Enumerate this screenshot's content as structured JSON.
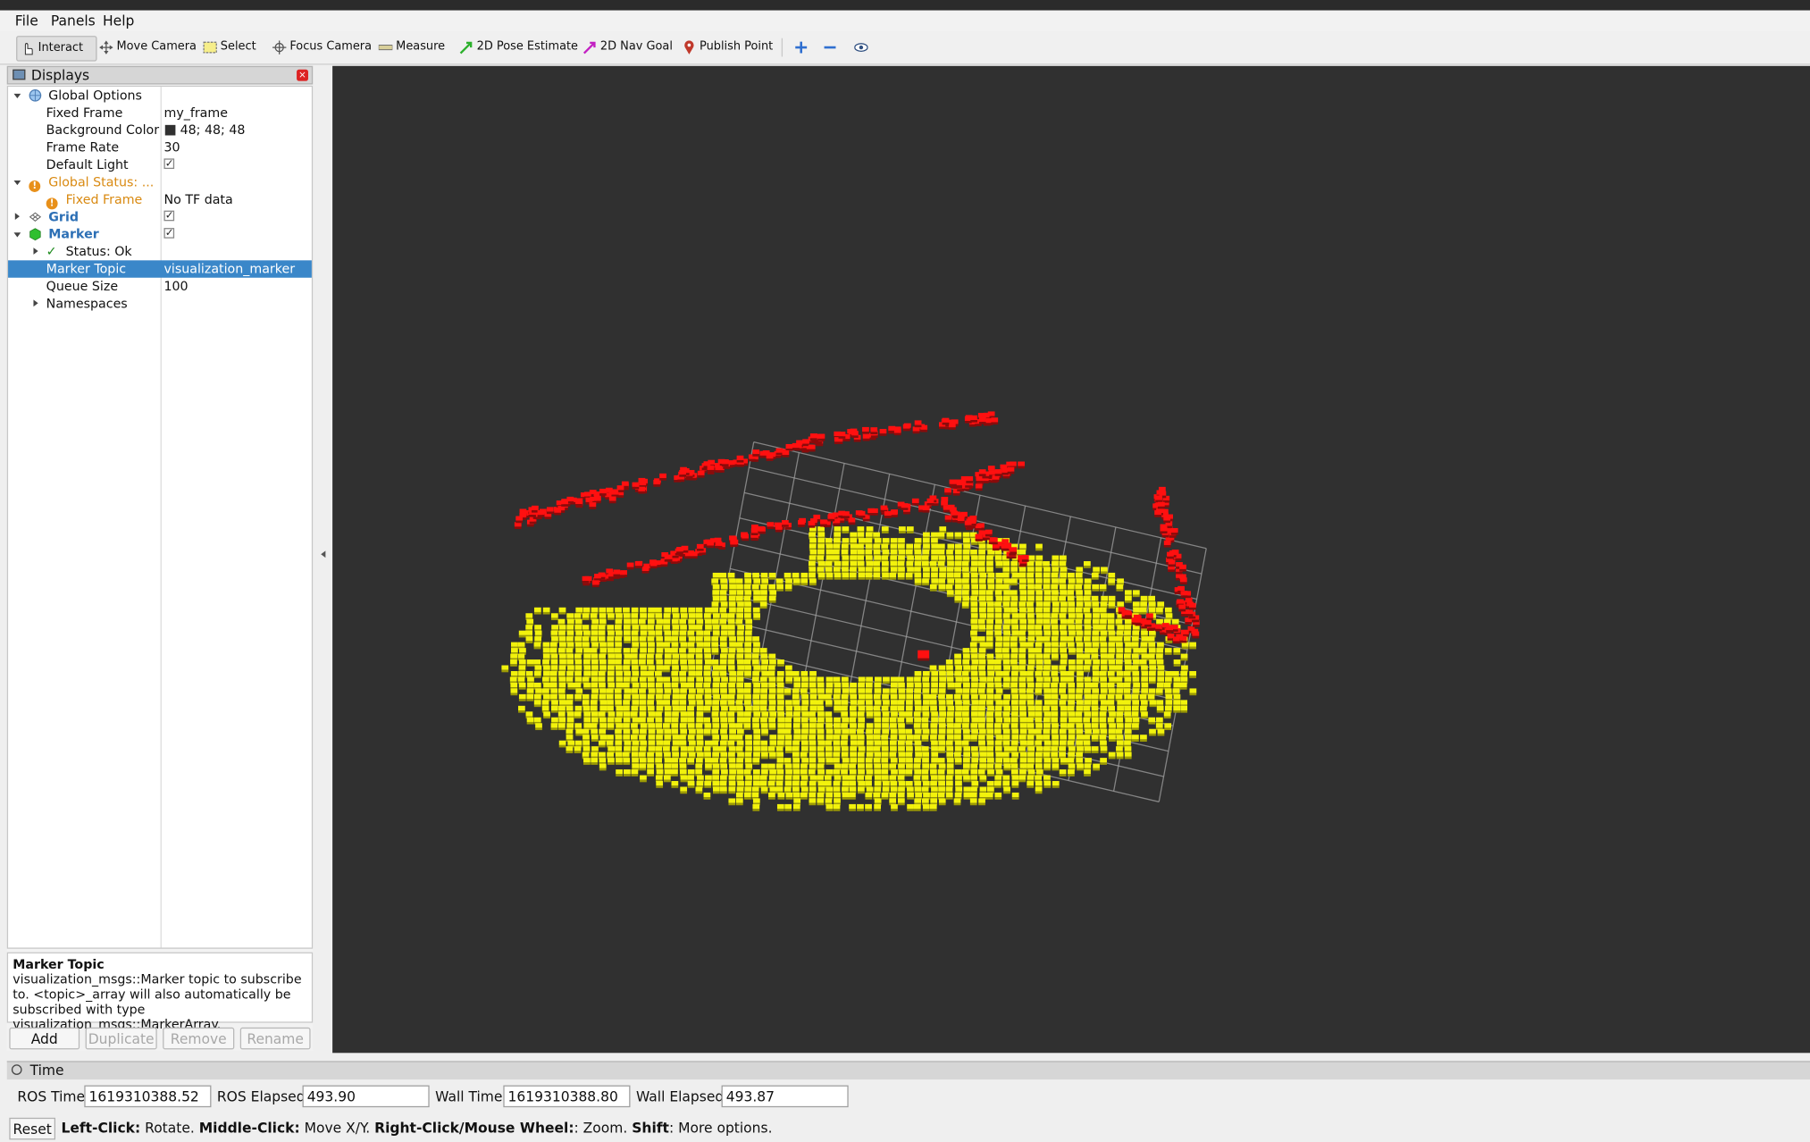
{
  "menu": {
    "file": "File",
    "panels": "Panels",
    "help": "Help"
  },
  "toolbar": {
    "interact": "Interact",
    "move_camera": "Move Camera",
    "select": "Select",
    "focus_camera": "Focus Camera",
    "measure": "Measure",
    "pose_estimate": "2D Pose Estimate",
    "nav_goal": "2D Nav Goal",
    "publish_point": "Publish Point"
  },
  "displays": {
    "title": "Displays",
    "rows": {
      "global_options": "Global Options",
      "fixed_frame_label": "Fixed Frame",
      "fixed_frame_value": "my_frame",
      "bg_label": "Background Color",
      "bg_value": "48; 48; 48",
      "frame_rate_label": "Frame Rate",
      "frame_rate_value": "30",
      "default_light_label": "Default Light",
      "global_status": "Global Status: ...",
      "status_fixed_frame": "Fixed Frame",
      "status_fixed_frame_value": "No TF data",
      "grid": "Grid",
      "marker": "Marker",
      "status_ok": "Status: Ok",
      "marker_topic_label": "Marker Topic",
      "marker_topic_value": "visualization_marker",
      "queue_size_label": "Queue Size",
      "queue_size_value": "100",
      "namespaces": "Namespaces"
    },
    "description": {
      "title": "Marker Topic",
      "body": "visualization_msgs::Marker topic to subscribe to. <topic>_array will also automatically be subscribed with type visualization_msgs::MarkerArray."
    },
    "buttons": {
      "add": "Add",
      "duplicate": "Duplicate",
      "remove": "Remove",
      "rename": "Rename"
    }
  },
  "colors": {
    "background": "#303030",
    "occupied": "#ff1010",
    "free": "#f2f20c",
    "grid": "#a0a0a0",
    "selection": "#3a87c9"
  },
  "time": {
    "title": "Time",
    "ros_time_label": "ROS Time:",
    "ros_time_value": "1619310388.52",
    "ros_elapsed_label": "ROS Elapsed:",
    "ros_elapsed_value": "493.90",
    "wall_time_label": "Wall Time:",
    "wall_time_value": "1619310388.80",
    "wall_elapsed_label": "Wall Elapsed:",
    "wall_elapsed_value": "493.87",
    "reset": "Reset",
    "hint_lc": "Left-Click:",
    "hint_lc_t": " Rotate. ",
    "hint_mc": "Middle-Click:",
    "hint_mc_t": " Move X/Y. ",
    "hint_rc": "Right-Click/Mouse Wheel:",
    "hint_rc_t": ": Zoom. ",
    "hint_sh": "Shift",
    "hint_sh_t": ": More options."
  }
}
